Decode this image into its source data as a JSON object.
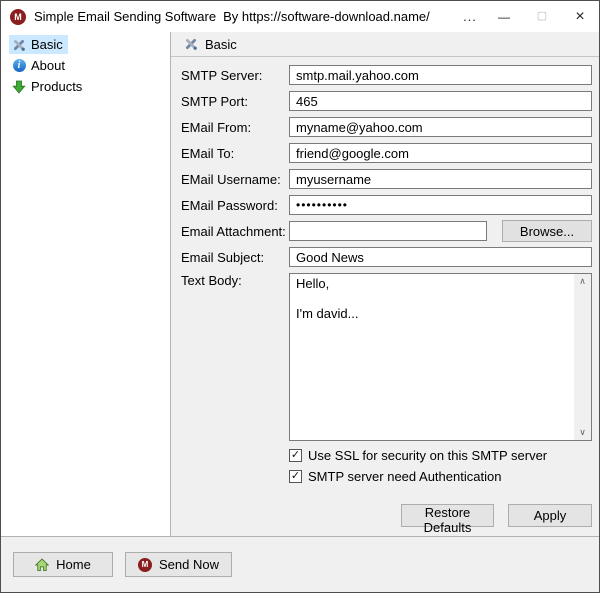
{
  "window": {
    "title": "Simple Email Sending Software",
    "byline": "By https://software-download.name/",
    "overflow": "..."
  },
  "icons": {
    "app_badge_letter": "M",
    "minimize": "—",
    "maximize": "▢",
    "close": "×",
    "scroll_up": "∧",
    "scroll_down": "∨",
    "check": "✓",
    "info_letter": "i"
  },
  "sidebar": {
    "items": [
      {
        "label": "Basic",
        "selected": true
      },
      {
        "label": "About",
        "selected": false
      },
      {
        "label": "Products",
        "selected": false
      }
    ]
  },
  "panel": {
    "header_title": "Basic",
    "fields": [
      {
        "label": "SMTP Server:",
        "value": "smtp.mail.yahoo.com"
      },
      {
        "label": "SMTP Port:",
        "value": "465"
      },
      {
        "label": "EMail From:",
        "value": "myname@yahoo.com"
      },
      {
        "label": "EMail To:",
        "value": "friend@google.com"
      },
      {
        "label": "EMail Username:",
        "value": "myusername"
      },
      {
        "label": "EMail Password:",
        "value": "••••••••••"
      },
      {
        "label": "Email Attachment:",
        "value": ""
      },
      {
        "label": "Email Subject:",
        "value": "Good News"
      }
    ],
    "browse_label": "Browse...",
    "text_body": {
      "label": "Text Body:",
      "value": "Hello,\n\nI'm david..."
    },
    "checkboxes": [
      {
        "label": "Use SSL for security on this SMTP server",
        "checked": true
      },
      {
        "label": "SMTP server need Authentication",
        "checked": true
      }
    ],
    "restore_defaults_label": "Restore Defaults",
    "apply_label": "Apply"
  },
  "footer": {
    "home_label": "Home",
    "send_now_label": "Send Now"
  },
  "colors": {
    "selected_item_bg": "#cce8ff",
    "panel_bg": "#f0f0f0",
    "app_badge_red": "#8b1e1e",
    "info_blue": "#1565c0",
    "products_green": "#3daa35",
    "home_green": "#a8d878"
  }
}
